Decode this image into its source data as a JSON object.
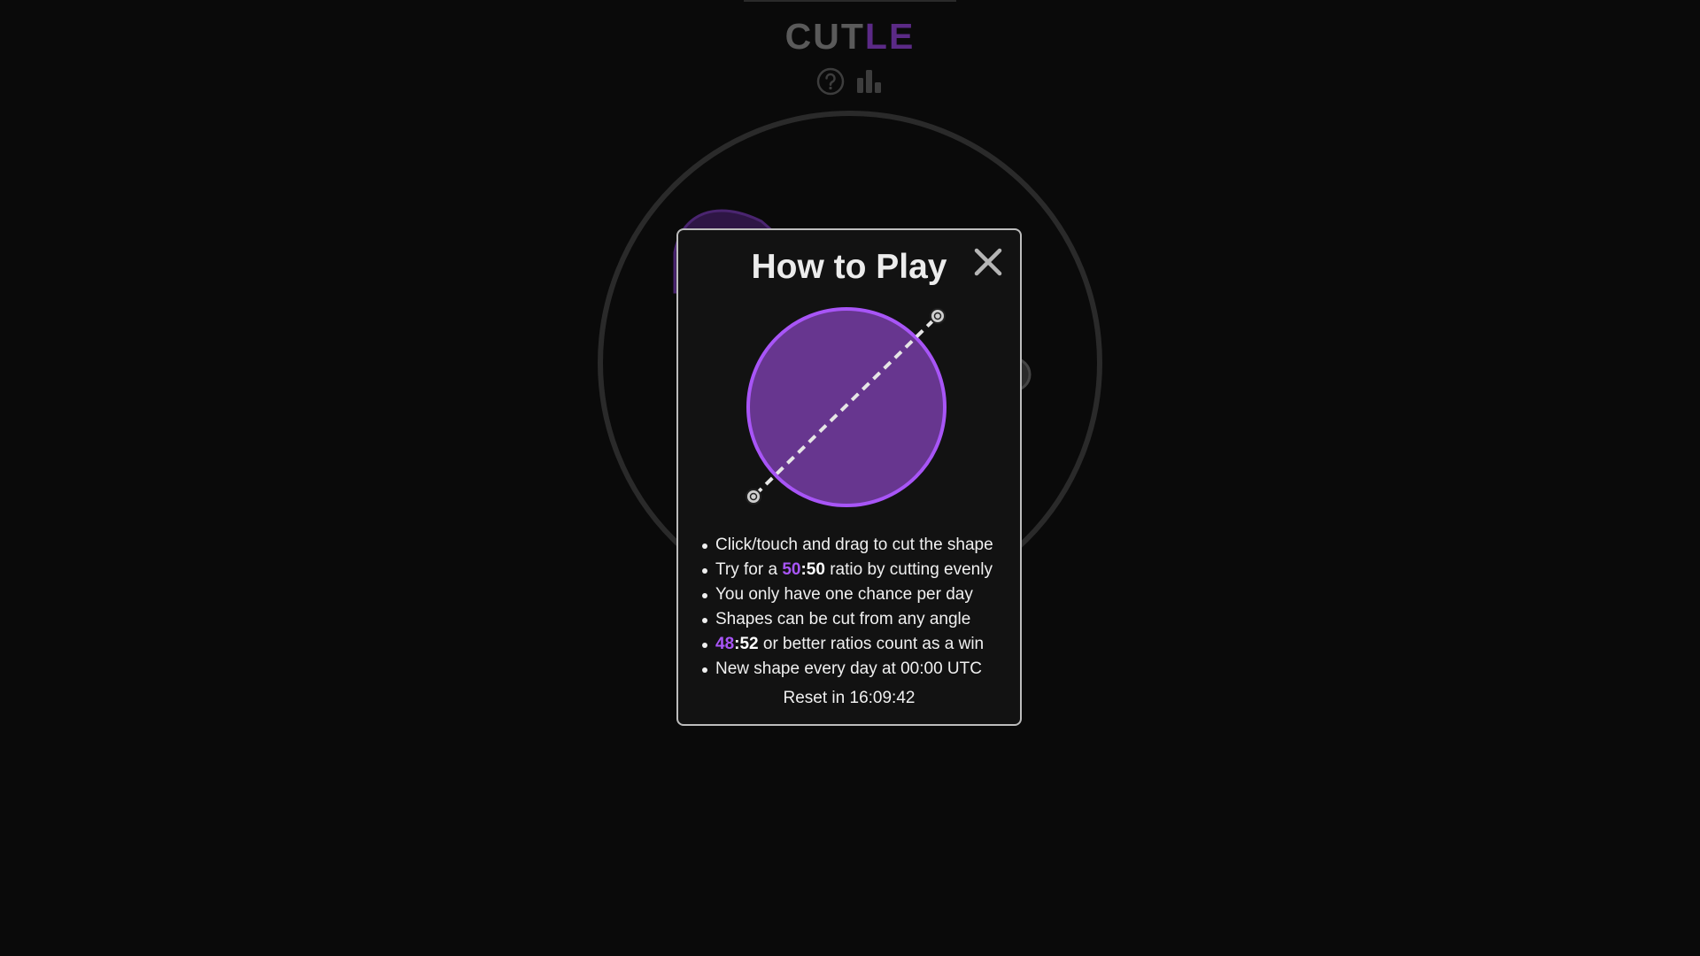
{
  "header": {
    "title_part1": "CUT",
    "title_part2": "LE",
    "help_icon": "question-circle-icon",
    "stats_icon": "bar-chart-icon"
  },
  "colors": {
    "background": "#0a0a0a",
    "accent_purple": "#a855f7",
    "shape_fill": "#67368f",
    "title_dim_purple": "#5b2a86"
  },
  "modal": {
    "title": "How to Play",
    "close_icon": "close-icon",
    "rules": {
      "rule1": "Click/touch and drag to cut the shape",
      "rule2_prefix": "Try for a ",
      "rule2_left": "50",
      "rule2_sep": ":",
      "rule2_right": "50",
      "rule2_suffix": " ratio by cutting evenly",
      "rule3": "You only have one chance per day",
      "rule4": "Shapes can be cut from any angle",
      "rule5_left": "48",
      "rule5_sep": ":",
      "rule5_right": "52",
      "rule5_suffix": " or better ratios count as a win",
      "rule6": "New shape every day at 00:00 UTC"
    },
    "reset_label": "Reset in",
    "reset_time": "16:09:42"
  }
}
